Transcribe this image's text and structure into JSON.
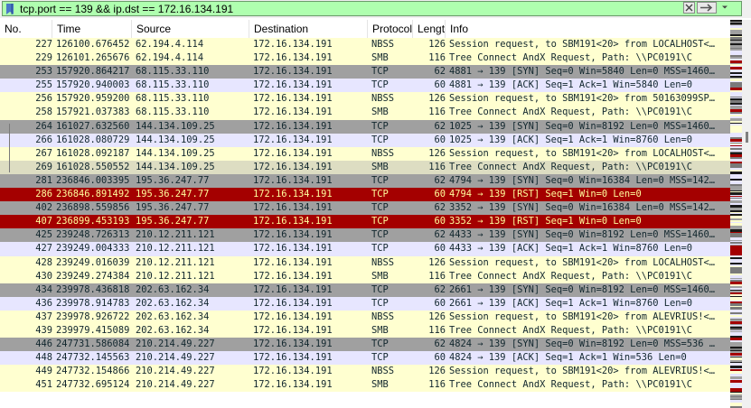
{
  "filter": {
    "value": "tcp.port == 139 && ip.dst == 172.16.134.191",
    "bookmark_icon": "bookmark-icon",
    "clear_icon": "clear-icon",
    "apply_icon": "arrow-right-icon",
    "dropdown_icon": "chevron-down-icon"
  },
  "columns": {
    "no": "No.",
    "time": "Time",
    "source": "Source",
    "destination": "Destination",
    "protocol": "Protocol",
    "length": "Lengtl",
    "info": "Info"
  },
  "colors": {
    "filter_bg": "#afffaf",
    "nbss_smb": "#ffffd0",
    "tcp_syn": "#a0a0a0",
    "tcp_ack": "#e7e6ff",
    "tcp_rst": "#a40000",
    "rst_text": "#fffc9c",
    "selected": "#ddddc2"
  },
  "packets": [
    {
      "no": "227",
      "time": "126100.676452",
      "src": "62.194.4.114",
      "dst": "172.16.134.191",
      "proto": "NBSS",
      "len": "126",
      "info": "Session request, to SBM191<20> from LOCALHOST<…",
      "style": "nbss"
    },
    {
      "no": "229",
      "time": "126101.265676",
      "src": "62.194.4.114",
      "dst": "172.16.134.191",
      "proto": "SMB",
      "len": "116",
      "info": "Tree Connect AndX Request, Path: \\\\PC0191\\C",
      "style": "nbss"
    },
    {
      "no": "253",
      "time": "157920.864217",
      "src": "68.115.33.110",
      "dst": "172.16.134.191",
      "proto": "TCP",
      "len": "62",
      "info": "4881 → 139 [SYN] Seq=0 Win=5840 Len=0 MSS=1460…",
      "style": "tcp"
    },
    {
      "no": "255",
      "time": "157920.940003",
      "src": "68.115.33.110",
      "dst": "172.16.134.191",
      "proto": "TCP",
      "len": "60",
      "info": "4881 → 139 [ACK] Seq=1 Ack=1 Win=5840 Len=0",
      "style": "ack"
    },
    {
      "no": "256",
      "time": "157920.959200",
      "src": "68.115.33.110",
      "dst": "172.16.134.191",
      "proto": "NBSS",
      "len": "126",
      "info": "Session request, to SBM191<20> from 50163099SP…",
      "style": "nbss"
    },
    {
      "no": "258",
      "time": "157921.037383",
      "src": "68.115.33.110",
      "dst": "172.16.134.191",
      "proto": "SMB",
      "len": "116",
      "info": "Tree Connect AndX Request, Path: \\\\PC0191\\C",
      "style": "nbss"
    },
    {
      "no": "264",
      "time": "161027.632560",
      "src": "144.134.109.25",
      "dst": "172.16.134.191",
      "proto": "TCP",
      "len": "62",
      "info": "1025 → 139 [SYN] Seq=0 Win=8192 Len=0 MSS=1460…",
      "style": "tcp"
    },
    {
      "no": "266",
      "time": "161028.080729",
      "src": "144.134.109.25",
      "dst": "172.16.134.191",
      "proto": "TCP",
      "len": "60",
      "info": "1025 → 139 [ACK] Seq=1 Ack=1 Win=8760 Len=0",
      "style": "ack"
    },
    {
      "no": "267",
      "time": "161028.092187",
      "src": "144.134.109.25",
      "dst": "172.16.134.191",
      "proto": "NBSS",
      "len": "126",
      "info": "Session request, to SBM191<20> from LOCALHOST<…",
      "style": "nbss"
    },
    {
      "no": "269",
      "time": "161028.550552",
      "src": "144.134.109.25",
      "dst": "172.16.134.191",
      "proto": "SMB",
      "len": "116",
      "info": "Tree Connect AndX Request, Path: \\\\PC0191\\C",
      "style": "sel"
    },
    {
      "no": "281",
      "time": "236846.003395",
      "src": "195.36.247.77",
      "dst": "172.16.134.191",
      "proto": "TCP",
      "len": "62",
      "info": "4794 → 139 [SYN] Seq=0 Win=16384 Len=0 MSS=142…",
      "style": "tcp"
    },
    {
      "no": "286",
      "time": "236846.891492",
      "src": "195.36.247.77",
      "dst": "172.16.134.191",
      "proto": "TCP",
      "len": "60",
      "info": "4794 → 139 [RST] Seq=1 Win=0 Len=0",
      "style": "rst"
    },
    {
      "no": "402",
      "time": "236898.559856",
      "src": "195.36.247.77",
      "dst": "172.16.134.191",
      "proto": "TCP",
      "len": "62",
      "info": "3352 → 139 [SYN] Seq=0 Win=16384 Len=0 MSS=142…",
      "style": "tcp"
    },
    {
      "no": "407",
      "time": "236899.453193",
      "src": "195.36.247.77",
      "dst": "172.16.134.191",
      "proto": "TCP",
      "len": "60",
      "info": "3352 → 139 [RST] Seq=1 Win=0 Len=0",
      "style": "rst"
    },
    {
      "no": "425",
      "time": "239248.726313",
      "src": "210.12.211.121",
      "dst": "172.16.134.191",
      "proto": "TCP",
      "len": "62",
      "info": "4433 → 139 [SYN] Seq=0 Win=8192 Len=0 MSS=1460…",
      "style": "tcp"
    },
    {
      "no": "427",
      "time": "239249.004333",
      "src": "210.12.211.121",
      "dst": "172.16.134.191",
      "proto": "TCP",
      "len": "60",
      "info": "4433 → 139 [ACK] Seq=1 Ack=1 Win=8760 Len=0",
      "style": "ack"
    },
    {
      "no": "428",
      "time": "239249.016039",
      "src": "210.12.211.121",
      "dst": "172.16.134.191",
      "proto": "NBSS",
      "len": "126",
      "info": "Session request, to SBM191<20> from LOCALHOST<…",
      "style": "nbss"
    },
    {
      "no": "430",
      "time": "239249.274384",
      "src": "210.12.211.121",
      "dst": "172.16.134.191",
      "proto": "SMB",
      "len": "116",
      "info": "Tree Connect AndX Request, Path: \\\\PC0191\\C",
      "style": "nbss"
    },
    {
      "no": "434",
      "time": "239978.436818",
      "src": "202.63.162.34",
      "dst": "172.16.134.191",
      "proto": "TCP",
      "len": "62",
      "info": "2661 → 139 [SYN] Seq=0 Win=8192 Len=0 MSS=1460…",
      "style": "tcp"
    },
    {
      "no": "436",
      "time": "239978.914783",
      "src": "202.63.162.34",
      "dst": "172.16.134.191",
      "proto": "TCP",
      "len": "60",
      "info": "2661 → 139 [ACK] Seq=1 Ack=1 Win=8760 Len=0",
      "style": "ack"
    },
    {
      "no": "437",
      "time": "239978.926722",
      "src": "202.63.162.34",
      "dst": "172.16.134.191",
      "proto": "NBSS",
      "len": "126",
      "info": "Session request, to SBM191<20> from ALEVRIUS!<…",
      "style": "nbss"
    },
    {
      "no": "439",
      "time": "239979.415089",
      "src": "202.63.162.34",
      "dst": "172.16.134.191",
      "proto": "SMB",
      "len": "116",
      "info": "Tree Connect AndX Request, Path: \\\\PC0191\\C",
      "style": "nbss"
    },
    {
      "no": "446",
      "time": "247731.586084",
      "src": "210.214.49.227",
      "dst": "172.16.134.191",
      "proto": "TCP",
      "len": "62",
      "info": "4824 → 139 [SYN] Seq=0 Win=8192 Len=0 MSS=536 …",
      "style": "tcp"
    },
    {
      "no": "448",
      "time": "247732.145563",
      "src": "210.214.49.227",
      "dst": "172.16.134.191",
      "proto": "TCP",
      "len": "60",
      "info": "4824 → 139 [ACK] Seq=1 Ack=1 Win=536 Len=0",
      "style": "ack"
    },
    {
      "no": "449",
      "time": "247732.154866",
      "src": "210.214.49.227",
      "dst": "172.16.134.191",
      "proto": "NBSS",
      "len": "126",
      "info": "Session request, to SBM191<20> from ALEVRIUS!<…",
      "style": "nbss"
    },
    {
      "no": "451",
      "time": "247732.695124",
      "src": "210.214.49.227",
      "dst": "172.16.134.191",
      "proto": "SMB",
      "len": "116",
      "info": "Tree Connect AndX Request, Path: \\\\PC0191\\C",
      "style": "nbss"
    }
  ]
}
